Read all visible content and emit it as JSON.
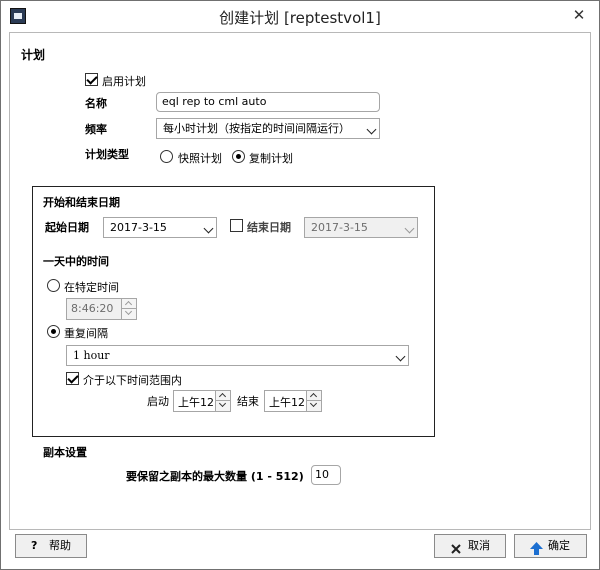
{
  "window": {
    "title": "创建计划 [reptestvol1]",
    "close_glyph": "✕"
  },
  "schedule": {
    "section_title": "计划",
    "enable_label": "启用计划",
    "enable_checked": true,
    "name_label": "名称",
    "name_value": "eql rep to cml auto",
    "frequency_label": "频率",
    "frequency_value": "每小时计划（按指定的时间间隔运行）",
    "type_label": "计划类型",
    "type_options": [
      {
        "label": "快照计划",
        "checked": false
      },
      {
        "label": "复制计划",
        "checked": true
      }
    ]
  },
  "dates": {
    "section_title": "开始和结束日期",
    "start_label": "起始日期",
    "start_value": "2017-3-15",
    "end_label": "结束日期",
    "end_checked": false,
    "end_value": "2017-3-15"
  },
  "time_of_day": {
    "section_title": "一天中的时间",
    "specific_label": "在特定时间",
    "specific_checked": false,
    "specific_value": "8:46:20",
    "repeat_label": "重复间隔",
    "repeat_checked": true,
    "repeat_value": "1 hour",
    "range_label": "介于以下时间范围内",
    "range_checked": true,
    "start_label": "启动",
    "start_value": "上午12",
    "end_label": "结束",
    "end_value": "上午12"
  },
  "replica": {
    "section_title": "副本设置",
    "max_label": "要保留之副本的最大数量 (1 - 512)",
    "max_value": "10"
  },
  "buttons": {
    "help": "帮助",
    "cancel": "取消",
    "ok": "确定"
  },
  "colors": {
    "ok_arrow": "#1c6fd1",
    "cancel_x": "#222222"
  }
}
